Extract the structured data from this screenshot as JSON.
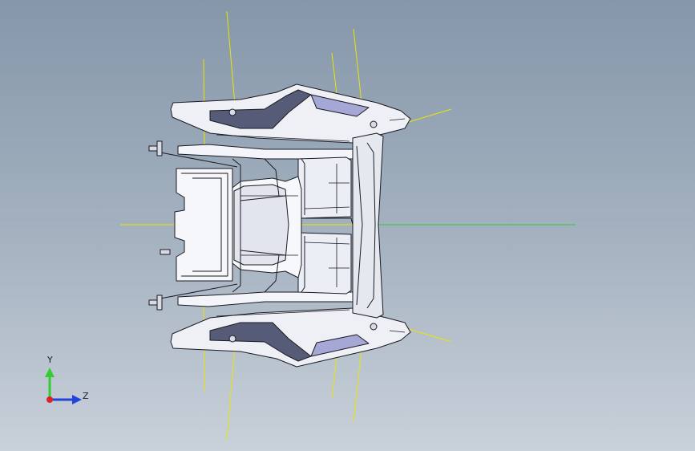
{
  "viewport": {
    "background_top": "#8597aa",
    "background_bottom": "#c9d1da",
    "model_outline_color": "#1a1a22",
    "model_fill_light": "#f2f3f8",
    "model_fill_shade": "#8c8fb8",
    "construction_line_color": "#e8e600",
    "center_line_color": "#33cc33"
  },
  "triad": {
    "y_label": "Y",
    "z_label": "Z",
    "y_color": "#33cc33",
    "z_color": "#2244dd",
    "origin_color": "#dd2222"
  }
}
